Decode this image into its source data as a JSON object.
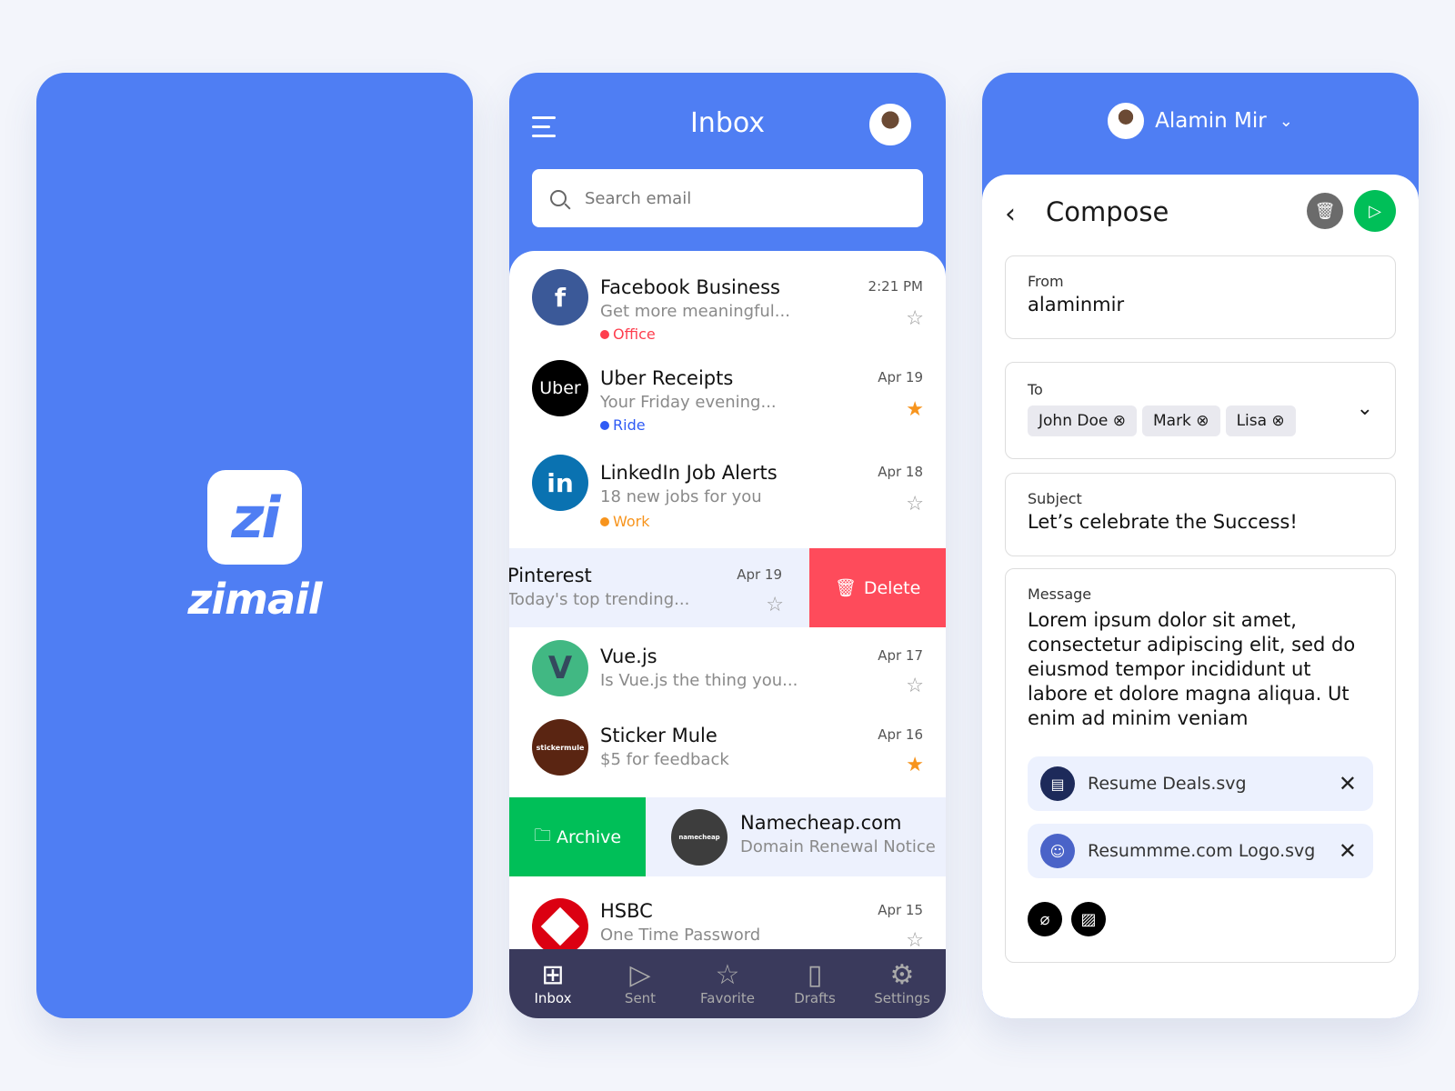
{
  "splash": {
    "logo_mark": "zi",
    "brand": "zimail"
  },
  "inbox": {
    "title": "Inbox",
    "search_placeholder": "Search email",
    "emails": [
      {
        "sender": "Facebook Business",
        "preview": "Get more meaningful...",
        "date": "2:21 PM",
        "tag": "Office",
        "tag_color": "#fe3e4e",
        "starred": false,
        "avatar_text": "f",
        "avatar_color": "#3b5998"
      },
      {
        "sender": "Uber Receipts",
        "preview": "Your Friday evening...",
        "date": "Apr 19",
        "tag": "Ride",
        "tag_color": "#2f5bf5",
        "starred": true,
        "avatar_text": "Uber",
        "avatar_color": "#000000"
      },
      {
        "sender": "LinkedIn Job Alerts",
        "preview": "18 new jobs for you",
        "date": "Apr 18",
        "tag": "Work",
        "tag_color": "#f7941d",
        "starred": false,
        "avatar_text": "in",
        "avatar_color": "#0a72b1"
      },
      {
        "sender": "Pinterest",
        "preview": "Today's top trending...",
        "date": "Apr 19",
        "starred": false,
        "swipe_action": "Delete"
      },
      {
        "sender": "Vue.js",
        "preview": "Is Vue.js the thing you...",
        "date": "Apr 17",
        "starred": false,
        "avatar_text": "V",
        "avatar_color": "#41b883"
      },
      {
        "sender": "Sticker Mule",
        "preview": "$5 for feedback",
        "date": "Apr 16",
        "starred": true,
        "avatar_text": "stickermule",
        "avatar_color": "#5a2512"
      },
      {
        "sender": "Namecheap.com",
        "preview": "Domain Renewal Notice",
        "swipe_action": "Archive",
        "avatar_text": "namecheap",
        "avatar_color": "#3d3d3d"
      },
      {
        "sender": "HSBC",
        "preview": "One Time Password",
        "date": "Apr 15",
        "starred": false,
        "avatar_color": "#db0011"
      }
    ],
    "nav": [
      {
        "label": "Inbox",
        "active": true
      },
      {
        "label": "Sent"
      },
      {
        "label": "Favorite"
      },
      {
        "label": "Drafts"
      },
      {
        "label": "Settings"
      }
    ]
  },
  "compose": {
    "user": "Alamin Mir",
    "title": "Compose",
    "from_label": "From",
    "from_value": "alaminmir",
    "to_label": "To",
    "recipients": [
      "John Doe",
      "Mark",
      "Lisa"
    ],
    "subject_label": "Subject",
    "subject_value": "Let’s celebrate the Success!",
    "message_label": "Message",
    "message_value": "Lorem ipsum dolor sit amet, consectetur adipiscing elit, sed do eiusmod tempor incididunt ut labore et dolore magna aliqua. Ut enim ad minim veniam",
    "attachments": [
      "Resume Deals.svg",
      "Resummme.com Logo.svg"
    ],
    "colors": {
      "send": "#00bf58",
      "delete": "#6b6b6b",
      "brand": "#4f7ef3"
    }
  }
}
